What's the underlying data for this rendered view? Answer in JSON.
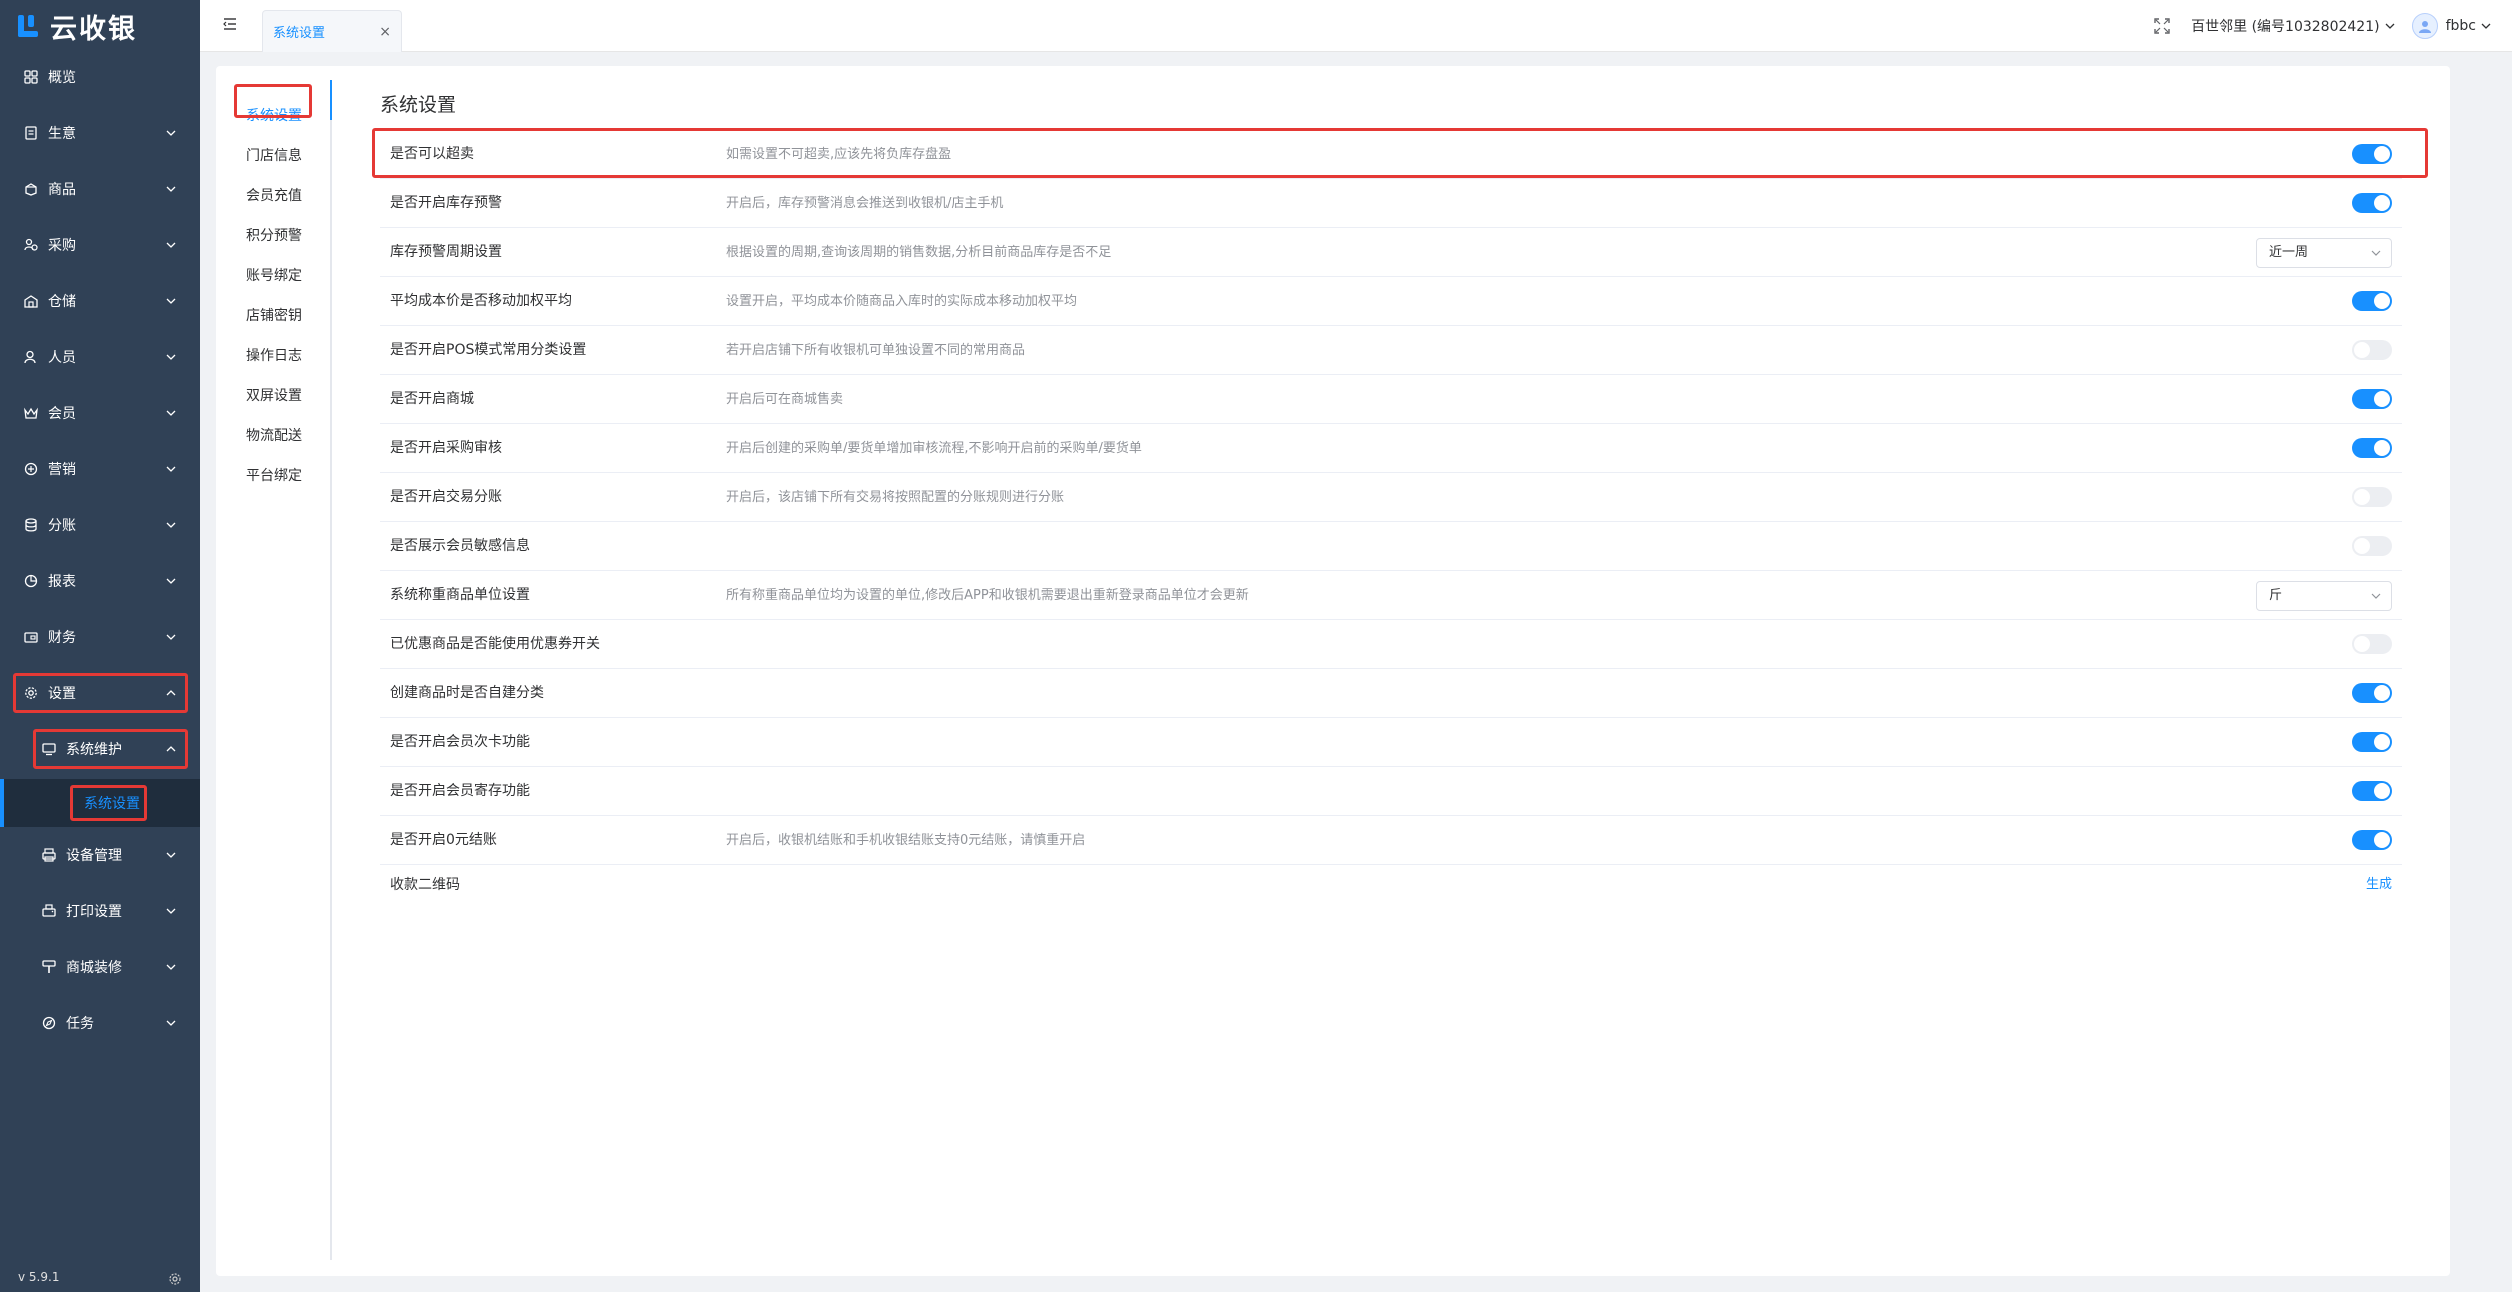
{
  "app": {
    "title": "云收银",
    "version": "v 5.9.1"
  },
  "colors": {
    "sidebar_bg": "#304156",
    "accent": "#1890ff",
    "highlight_box": "#e53935"
  },
  "sidebar": {
    "items": [
      {
        "label": "概览",
        "icon": "grid-icon"
      },
      {
        "label": "生意",
        "icon": "document-icon"
      },
      {
        "label": "商品",
        "icon": "box-icon"
      },
      {
        "label": "采购",
        "icon": "people-icon"
      },
      {
        "label": "仓储",
        "icon": "warehouse-icon"
      },
      {
        "label": "人员",
        "icon": "person-icon"
      },
      {
        "label": "会员",
        "icon": "crown-icon"
      },
      {
        "label": "营销",
        "icon": "marketing-icon"
      },
      {
        "label": "分账",
        "icon": "database-icon"
      },
      {
        "label": "报表",
        "icon": "pie-chart-icon"
      },
      {
        "label": "财务",
        "icon": "wallet-icon"
      },
      {
        "label": "设置",
        "icon": "gear-icon"
      }
    ],
    "sub_item": {
      "label": "系统维护",
      "icon": "monitor-icon"
    },
    "sub_sub_item": {
      "label": "系统设置"
    },
    "more_items": [
      {
        "label": "设备管理",
        "icon": "printer-icon"
      },
      {
        "label": "打印设置",
        "icon": "print-setting-icon"
      },
      {
        "label": "商城装修",
        "icon": "paint-icon"
      },
      {
        "label": "任务",
        "icon": "compass-icon"
      }
    ]
  },
  "topbar": {
    "tab_label": "系统设置",
    "store_name": "百世邻里 (编号1032802421)",
    "user_name": "fbbc"
  },
  "settings_nav": [
    "系统设置",
    "门店信息",
    "会员充值",
    "积分预警",
    "账号绑定",
    "店铺密钥",
    "操作日志",
    "双屏设置",
    "物流配送",
    "平台绑定"
  ],
  "content": {
    "title": "系统设置",
    "rows": [
      {
        "label": "是否可以超卖",
        "desc": "如需设置不可超卖,应该先将负库存盘盈",
        "control": "switch",
        "on": true
      },
      {
        "label": "是否开启库存预警",
        "desc": "开启后，库存预警消息会推送到收银机/店主手机",
        "control": "switch",
        "on": true
      },
      {
        "label": "库存预警周期设置",
        "desc": "根据设置的周期,查询该周期的销售数据,分析目前商品库存是否不足",
        "control": "select",
        "value": "近一周"
      },
      {
        "label": "平均成本价是否移动加权平均",
        "desc": "设置开启，平均成本价随商品入库时的实际成本移动加权平均",
        "control": "switch",
        "on": true
      },
      {
        "label": "是否开启POS模式常用分类设置",
        "desc": "若开启店铺下所有收银机可单独设置不同的常用商品",
        "control": "switch",
        "on": false
      },
      {
        "label": "是否开启商城",
        "desc": "开启后可在商城售卖",
        "control": "switch",
        "on": true
      },
      {
        "label": "是否开启采购审核",
        "desc": "开启后创建的采购单/要货单增加审核流程,不影响开启前的采购单/要货单",
        "control": "switch",
        "on": true
      },
      {
        "label": "是否开启交易分账",
        "desc": "开启后，该店铺下所有交易将按照配置的分账规则进行分账",
        "control": "switch",
        "on": false
      },
      {
        "label": "是否展示会员敏感信息",
        "desc": "",
        "control": "switch",
        "on": false
      },
      {
        "label": "系统称重商品单位设置",
        "desc": "所有称重商品单位均为设置的单位,修改后APP和收银机需要退出重新登录商品单位才会更新",
        "control": "select",
        "value": "斤"
      },
      {
        "label": "已优惠商品是否能使用优惠券开关",
        "desc": "",
        "control": "switch",
        "on": false
      },
      {
        "label": "创建商品时是否自建分类",
        "desc": "",
        "control": "switch",
        "on": true
      },
      {
        "label": "是否开启会员次卡功能",
        "desc": "",
        "control": "switch",
        "on": true
      },
      {
        "label": "是否开启会员寄存功能",
        "desc": "",
        "control": "switch",
        "on": true
      },
      {
        "label": "是否开启0元结账",
        "desc": "开启后，收银机结账和手机收银结账支持0元结账，请慎重开启",
        "control": "switch",
        "on": true
      },
      {
        "label": "收款二维码",
        "desc": "",
        "control": "link",
        "link_label": "生成"
      }
    ]
  }
}
